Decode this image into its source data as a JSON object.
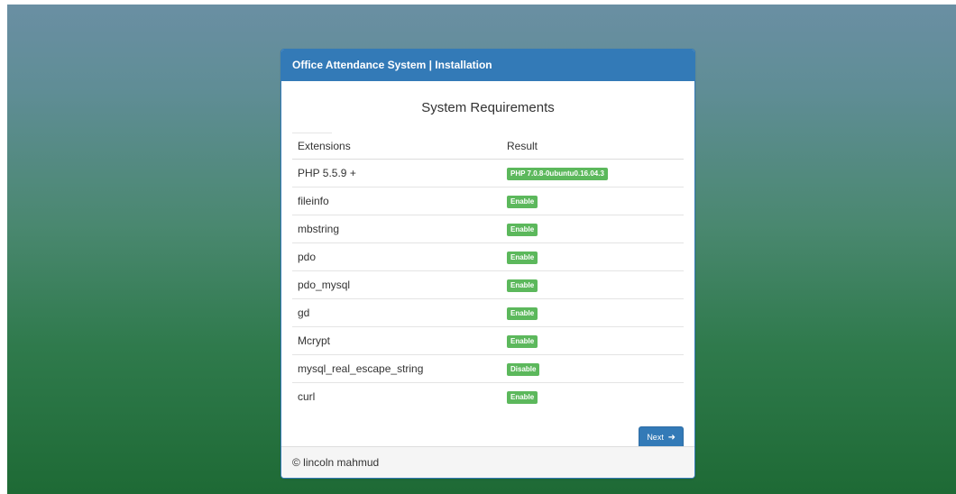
{
  "panel": {
    "title": "Office Attendance System | Installation"
  },
  "section": {
    "title": "System Requirements"
  },
  "table": {
    "headers": [
      "Extensions",
      "Result"
    ],
    "rows": [
      {
        "extension": "PHP 5.5.9 +",
        "result": "PHP 7.0.8-0ubuntu0.16.04.3"
      },
      {
        "extension": "fileinfo",
        "result": "Enable"
      },
      {
        "extension": "mbstring",
        "result": "Enable"
      },
      {
        "extension": "pdo",
        "result": "Enable"
      },
      {
        "extension": "pdo_mysql",
        "result": "Enable"
      },
      {
        "extension": "gd",
        "result": "Enable"
      },
      {
        "extension": "Mcrypt",
        "result": "Enable"
      },
      {
        "extension": "mysql_real_escape_string",
        "result": "Disable"
      },
      {
        "extension": "curl",
        "result": "Enable"
      }
    ]
  },
  "buttons": {
    "next_label": "Next",
    "next_icon": "arrow-right-icon"
  },
  "footer": {
    "text": "© lincoln mahmud"
  },
  "colors": {
    "primary": "#337ab7",
    "success": "#5cb85c"
  }
}
